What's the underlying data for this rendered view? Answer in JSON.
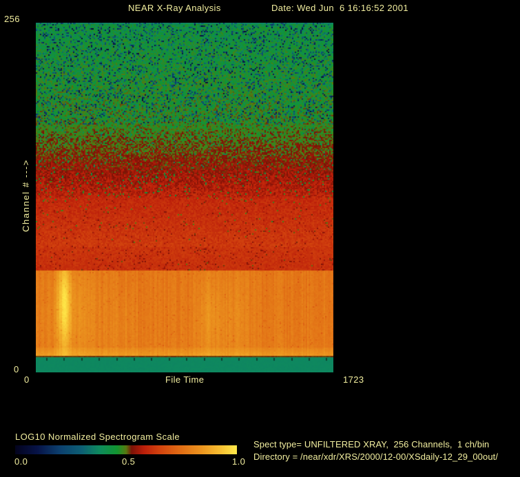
{
  "header": {
    "title": "NEAR X-Ray Analysis",
    "date_label": "Date: Wed Jun  6 16:16:52 2001"
  },
  "plot": {
    "y_axis": {
      "label": "Channel # --->",
      "top_tick": "256",
      "bottom_tick": "0"
    },
    "x_axis": {
      "label": "File Time",
      "left_tick": "0",
      "right_tick": "1723"
    }
  },
  "colorbar": {
    "title": "LOG10 Normalized Spectrogram Scale",
    "ticks": [
      "0.0",
      "0.5",
      "1.0"
    ]
  },
  "info": {
    "line1": "Spect type= UNFILTERED XRAY,  256 Channels,  1 ch/bin",
    "line2": "Directory = /near/xdr/XRS/2000/12-00/XSdaily-12_29_00out/"
  },
  "colors": {
    "background": "#000000",
    "text": "#f2ee9f",
    "bottom_teal_band": "#0d8a63",
    "tick_nub": "#0b4330"
  },
  "chart_data": {
    "type": "heatmap",
    "title": "NEAR X-Ray Analysis",
    "xlabel": "File Time",
    "ylabel": "Channel # --->",
    "xlim": [
      0,
      1723
    ],
    "ylim": [
      0,
      256
    ],
    "channels": 256,
    "ch_per_bin": 1,
    "spect_type": "UNFILTERED XRAY",
    "value_scale": {
      "label": "LOG10 Normalized Spectrogram Scale",
      "range": [
        0.0,
        1.0
      ],
      "mid_tick": 0.5
    },
    "colormap_stops": [
      {
        "p": 0.0,
        "c": "#03031d"
      },
      {
        "p": 0.1,
        "c": "#071347"
      },
      {
        "p": 0.2,
        "c": "#0c3f6e"
      },
      {
        "p": 0.3,
        "c": "#0d5f74"
      },
      {
        "p": 0.38,
        "c": "#0e8a5e"
      },
      {
        "p": 0.46,
        "c": "#129530"
      },
      {
        "p": 0.5,
        "c": "#577a10"
      },
      {
        "p": 0.525,
        "c": "#7a1206"
      },
      {
        "p": 0.58,
        "c": "#bb1e0a"
      },
      {
        "p": 0.65,
        "c": "#d2420e"
      },
      {
        "p": 0.74,
        "c": "#e06a14"
      },
      {
        "p": 0.84,
        "c": "#ec951f"
      },
      {
        "p": 0.93,
        "c": "#f7c133"
      },
      {
        "p": 1.0,
        "c": "#ffe94a"
      }
    ],
    "bands": [
      {
        "name": "top-edge-teal",
        "t0": 0.0,
        "t1": 0.005,
        "ch": [
          255,
          256
        ],
        "v0": 0.375,
        "v1": 0.375,
        "amp": 0.03,
        "speckle_p": 0.25,
        "speckle_drop": 0.22,
        "striping": 0,
        "streaks": false
      },
      {
        "name": "high-channel-green",
        "t0": 0.005,
        "t1": 0.29,
        "ch": [
          182,
          255
        ],
        "v0": 0.435,
        "v1": 0.478,
        "amp": 0.09,
        "speckle_p": 0.24,
        "speckle_drop": 0.36,
        "striping": 0,
        "streaks": false
      },
      {
        "name": "green-red-transition",
        "t0": 0.29,
        "t1": 0.5,
        "ch": [
          128,
          182
        ],
        "v0": 0.478,
        "v1": 0.59,
        "amp": 0.075,
        "speckle_p": 0.08,
        "speckle_drop": 0.16,
        "striping": 0,
        "streaks": false
      },
      {
        "name": "red-mid-channels",
        "t0": 0.5,
        "t1": 0.643,
        "ch": [
          91,
          128
        ],
        "v0": 0.6,
        "v1": 0.635,
        "amp": 0.05,
        "speckle_p": 0.07,
        "speckle_drop": 0.12,
        "striping": 0,
        "streaks": false
      },
      {
        "name": "deep-red",
        "t0": 0.643,
        "t1": 0.707,
        "ch": [
          75,
          91
        ],
        "v0": 0.625,
        "v1": 0.615,
        "amp": 0.04,
        "speckle_p": 0.12,
        "speckle_drop": 0.1,
        "striping": 0,
        "streaks": false
      },
      {
        "name": "orange-low-channels",
        "t0": 0.707,
        "t1": 0.93,
        "ch": [
          18,
          75
        ],
        "v0": 0.772,
        "v1": 0.78,
        "amp": 0.024,
        "speckle_p": 0.05,
        "speckle_drop": 0.06,
        "striping": 0.02,
        "streaks": true
      },
      {
        "name": "orange-bright-bottom",
        "t0": 0.93,
        "t1": 0.953,
        "ch": [
          12,
          18
        ],
        "v0": 0.8,
        "v1": 0.85,
        "amp": 0.02,
        "speckle_p": 0.03,
        "speckle_drop": 0.04,
        "striping": 0.015,
        "streaks": true
      },
      {
        "name": "separator-line",
        "t0": 0.953,
        "t1": 0.9575,
        "ch": [
          11,
          12
        ],
        "v0": 0.515,
        "v1": 0.515,
        "amp": 0.01,
        "speckle_p": 0.0,
        "speckle_drop": 0.0,
        "striping": 0,
        "streaks": false
      },
      {
        "name": "bottom-teal-flat",
        "t0": 0.9575,
        "t1": 1.0,
        "ch": [
          0,
          11
        ],
        "v0": 0.375,
        "v1": 0.375,
        "amp": 0.008,
        "speckle_p": 0.0,
        "speckle_drop": 0.0,
        "striping": 0,
        "streaks": false
      }
    ],
    "streaks": [
      {
        "name": "bright-flare",
        "x": 0.095,
        "sx": 0.016,
        "tc": 0.8,
        "ts": 0.1,
        "amp": 0.165
      },
      {
        "name": "flare-glow",
        "x": 0.13,
        "sx": 0.065,
        "tc": 0.83,
        "ts": 0.1,
        "amp": 0.045
      },
      {
        "name": "faint-streak-1",
        "x": 0.3,
        "sx": 0.03,
        "tc": 0.85,
        "ts": 0.09,
        "amp": 0.022
      },
      {
        "name": "faint-streak-2",
        "x": 0.585,
        "sx": 0.028,
        "tc": 0.84,
        "ts": 0.09,
        "amp": 0.05
      },
      {
        "name": "faint-streak-3",
        "x": 0.665,
        "sx": 0.035,
        "tc": 0.84,
        "ts": 0.09,
        "amp": 0.03
      }
    ],
    "x_ticks": {
      "spacing": 25.4,
      "offset": 15,
      "width": 2,
      "height": 4
    },
    "grid": false,
    "legend": "none"
  }
}
